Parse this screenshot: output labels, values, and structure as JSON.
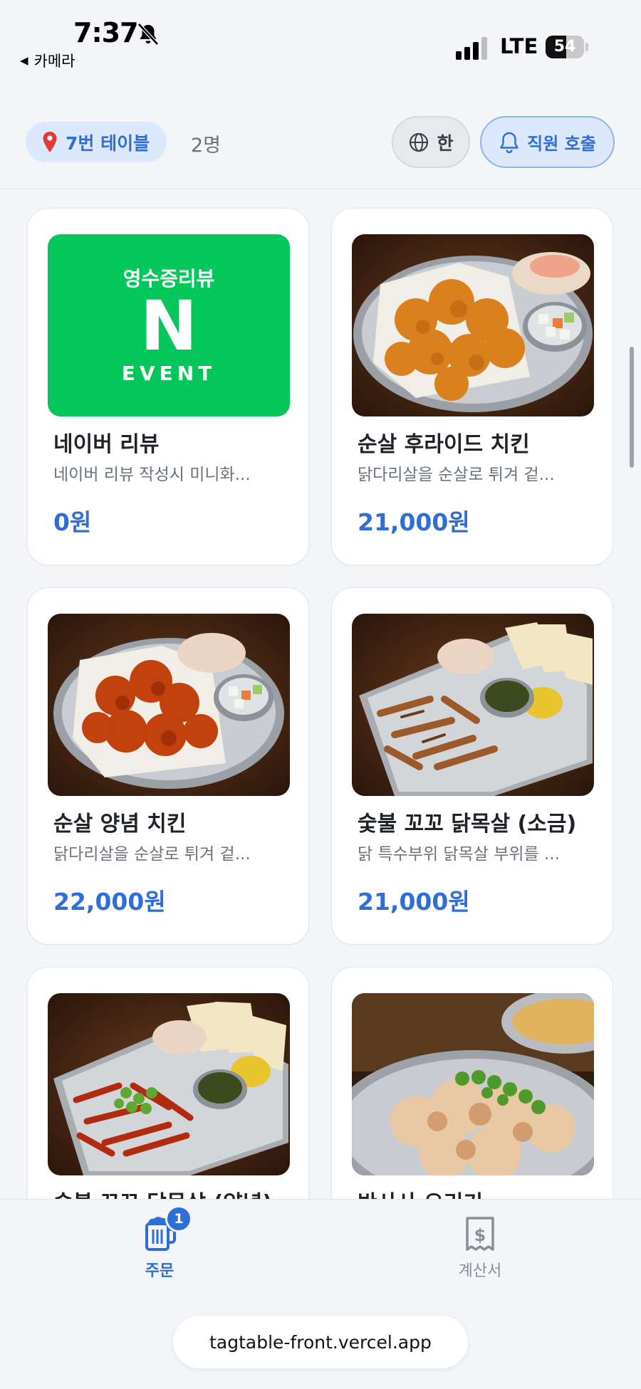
{
  "status_bar": {
    "time": "7:37",
    "back_app": "카메라",
    "network": "LTE",
    "battery_level": "54",
    "battery_fraction": 0.54
  },
  "header": {
    "table_label": "7번 테이블",
    "guest_count": "2명",
    "language_label": "한",
    "call_staff_label": "직원 호출"
  },
  "event_badge": {
    "top_text": "영수증리뷰",
    "letter": "N",
    "bottom_text": "EVENT",
    "color": "#03c75a"
  },
  "menu": {
    "items": [
      {
        "name": "네이버 리뷰",
        "description": "네이버 리뷰 작성시 미니화...",
        "price": "0원",
        "image": "naver-review-event"
      },
      {
        "name": "순살 후라이드 치킨",
        "description": "닭다리살을 순살로 튀겨 겉...",
        "price": "21,000원",
        "image": "fried-chicken"
      },
      {
        "name": "순살 양념 치킨",
        "description": "닭다리살을 순살로 튀겨 겉...",
        "price": "22,000원",
        "image": "seasoned-chicken"
      },
      {
        "name": "숯불 꼬꼬 닭목살 (소금)",
        "description": "닭 특수부위 닭목살 부위를 ...",
        "price": "21,000원",
        "image": "charcoal-neck-salt"
      },
      {
        "name": "숯불 꼬꼬 닭목살 (양념)",
        "description": "",
        "price": "",
        "image": "charcoal-neck-spicy"
      },
      {
        "name": "반사사 오리기",
        "description": "",
        "price": "",
        "image": "skewer-dish"
      }
    ]
  },
  "bottom_nav": {
    "order_label": "주문",
    "order_badge": "1",
    "bill_label": "계산서",
    "url": "tagtable-front.vercel.app"
  },
  "colors": {
    "accent": "#2f6ed6",
    "accent_soft": "#dce8fb",
    "background": "#f3f5f8"
  }
}
